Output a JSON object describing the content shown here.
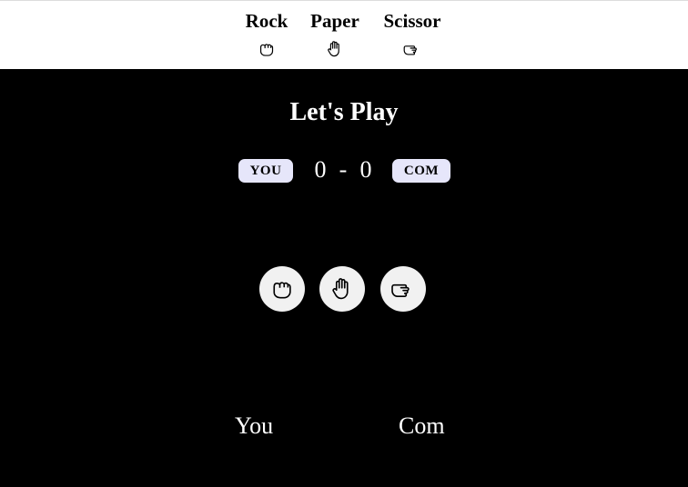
{
  "choices": [
    {
      "label": "Rock",
      "icon": "fist-icon"
    },
    {
      "label": "Paper",
      "icon": "open-hand-icon"
    },
    {
      "label": "Scissor",
      "icon": "pointing-hand-icon"
    }
  ],
  "game": {
    "title": "Let's Play",
    "you_badge": "YOU",
    "com_badge": "COM",
    "you_score": "0",
    "separator": "-",
    "com_score": "0"
  },
  "players": {
    "you_label": "You",
    "com_label": "Com"
  },
  "colors": {
    "background": "#000000",
    "badge": "#e6e6fa",
    "button": "#f1f1f1",
    "header_bg": "#ffffff"
  }
}
